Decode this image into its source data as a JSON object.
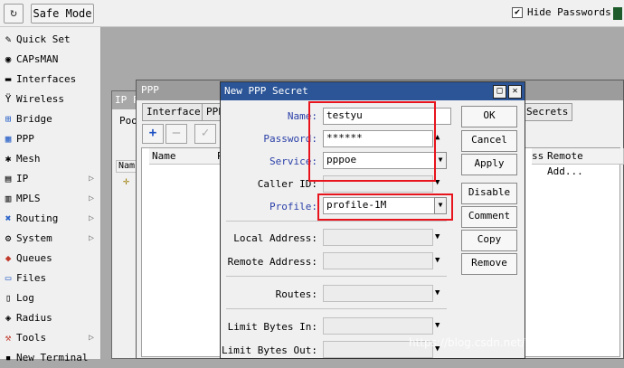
{
  "toolbar": {
    "refresh_icon": "↻",
    "safe_mode_label": "Safe Mode",
    "hide_passwords_label": "Hide Passwords",
    "hide_passwords_checked": "✔"
  },
  "sidebar": {
    "items": [
      {
        "label": "Quick Set",
        "icon": "✎",
        "submenu": ""
      },
      {
        "label": "CAPsMAN",
        "icon": "◉",
        "submenu": ""
      },
      {
        "label": "Interfaces",
        "icon": "▬",
        "submenu": ""
      },
      {
        "label": "Wireless",
        "icon": "Ϋ",
        "submenu": ""
      },
      {
        "label": "Bridge",
        "icon": "⊞",
        "submenu": ""
      },
      {
        "label": "PPP",
        "icon": "▦",
        "submenu": ""
      },
      {
        "label": "Mesh",
        "icon": "✱",
        "submenu": ""
      },
      {
        "label": "IP",
        "icon": "▤",
        "submenu": "▷"
      },
      {
        "label": "MPLS",
        "icon": "▥",
        "submenu": "▷"
      },
      {
        "label": "Routing",
        "icon": "✖",
        "submenu": "▷"
      },
      {
        "label": "System",
        "icon": "⚙",
        "submenu": "▷"
      },
      {
        "label": "Queues",
        "icon": "◆",
        "submenu": ""
      },
      {
        "label": "Files",
        "icon": "▭",
        "submenu": ""
      },
      {
        "label": "Log",
        "icon": "▯",
        "submenu": ""
      },
      {
        "label": "Radius",
        "icon": "◈",
        "submenu": ""
      },
      {
        "label": "Tools",
        "icon": "⚒",
        "submenu": "▷"
      },
      {
        "label": "New Terminal",
        "icon": "▪",
        "submenu": ""
      }
    ]
  },
  "ip_window": {
    "title": "IP F",
    "tab": "Poo",
    "col": "Nam",
    "row_icon": "✛"
  },
  "ppp_window": {
    "title": "PPP",
    "tabs": [
      "Interface",
      "PPP"
    ],
    "tab_secrets": "Secrets",
    "tools": [
      "+",
      "—",
      "✓"
    ],
    "columns": [
      "Name",
      "P"
    ],
    "columns_right": [
      "ss",
      "Remote Add..."
    ]
  },
  "secret_dialog": {
    "title": "New PPP Secret",
    "fields": {
      "name": {
        "label": "Name:",
        "value": "testyu"
      },
      "password": {
        "label": "Password:",
        "value": "******"
      },
      "service": {
        "label": "Service:",
        "value": "pppoe"
      },
      "caller_id": {
        "label": "Caller ID:",
        "value": ""
      },
      "profile": {
        "label": "Profile:",
        "value": "profile-1M"
      },
      "local_address": {
        "label": "Local Address:",
        "value": ""
      },
      "remote_address": {
        "label": "Remote Address:",
        "value": ""
      },
      "routes": {
        "label": "Routes:",
        "value": ""
      },
      "limit_bytes_in": {
        "label": "Limit Bytes In:",
        "value": ""
      },
      "limit_bytes_out": {
        "label": "Limit Bytes Out:",
        "value": ""
      }
    },
    "buttons": {
      "ok": "OK",
      "cancel": "Cancel",
      "apply": "Apply",
      "disable": "Disable",
      "comment": "Comment",
      "copy": "Copy",
      "remove": "Remove"
    },
    "window_buttons": {
      "maximize": "□",
      "close": "✕"
    }
  },
  "watermark": "https://blog.csdn.net/yuzhentong",
  "colors": {
    "highlight_box": "#e8141d",
    "title_active": "#2b5597"
  }
}
